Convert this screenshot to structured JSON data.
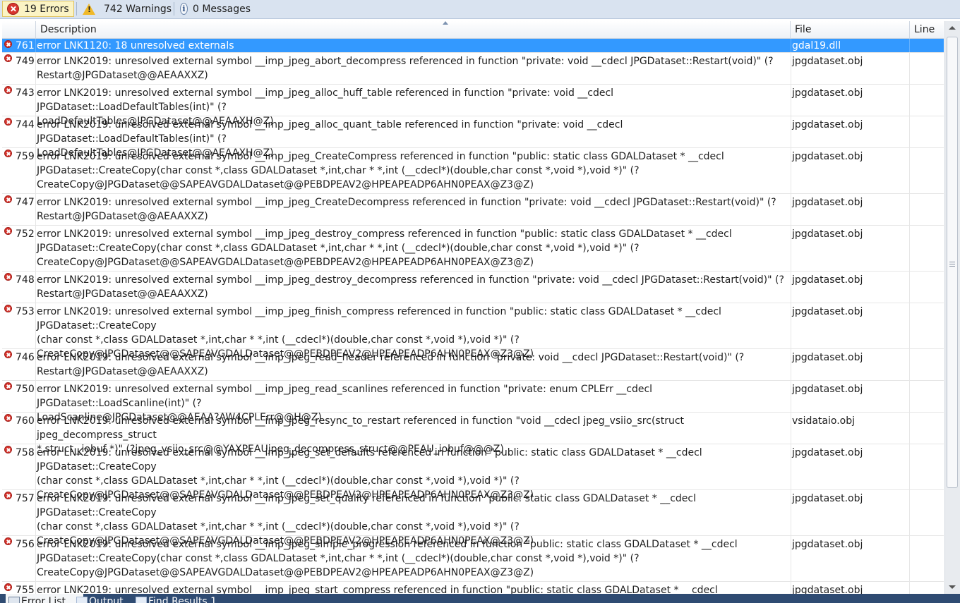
{
  "toolbar": {
    "errors_label": "19 Errors",
    "warnings_label": "742 Warnings",
    "messages_label": "0 Messages",
    "errors_icon": "error-circle-icon",
    "warnings_icon": "warning-triangle-icon",
    "messages_icon": "info-icon"
  },
  "columns": {
    "description": "Description",
    "file": "File",
    "line": "Line"
  },
  "rows": [
    {
      "num": "761",
      "desc": "error LNK1120: 18 unresolved externals",
      "file": "gdal19.dll",
      "selected": true
    },
    {
      "num": "749",
      "desc": "error LNK2019: unresolved external symbol __imp_jpeg_abort_decompress referenced in function \"private: void __cdecl JPGDataset::Restart(void)\" (?\nRestart@JPGDataset@@AEAAXXZ)",
      "file": "jpgdataset.obj"
    },
    {
      "num": "743",
      "desc": "error LNK2019: unresolved external symbol __imp_jpeg_alloc_huff_table referenced in function \"private: void __cdecl JPGDataset::LoadDefaultTables(int)\" (?\nLoadDefaultTables@JPGDataset@@AEAAXH@Z)",
      "file": "jpgdataset.obj"
    },
    {
      "num": "744",
      "desc": "error LNK2019: unresolved external symbol __imp_jpeg_alloc_quant_table referenced in function \"private: void __cdecl JPGDataset::LoadDefaultTables(int)\" (?\nLoadDefaultTables@JPGDataset@@AEAAXH@Z)",
      "file": "jpgdataset.obj"
    },
    {
      "num": "759",
      "desc": "error LNK2019: unresolved external symbol __imp_jpeg_CreateCompress referenced in function \"public: static class GDALDataset * __cdecl\nJPGDataset::CreateCopy(char const *,class GDALDataset *,int,char * *,int (__cdecl*)(double,char const *,void *),void *)\" (?\nCreateCopy@JPGDataset@@SAPEAVGDALDataset@@PEBDPEAV2@HPEAPEADP6AHN0PEAX@Z3@Z)",
      "file": "jpgdataset.obj"
    },
    {
      "num": "747",
      "desc": "error LNK2019: unresolved external symbol __imp_jpeg_CreateDecompress referenced in function \"private: void __cdecl JPGDataset::Restart(void)\" (?\nRestart@JPGDataset@@AEAAXXZ)",
      "file": "jpgdataset.obj"
    },
    {
      "num": "752",
      "desc": "error LNK2019: unresolved external symbol __imp_jpeg_destroy_compress referenced in function \"public: static class GDALDataset * __cdecl\nJPGDataset::CreateCopy(char const *,class GDALDataset *,int,char * *,int (__cdecl*)(double,char const *,void *),void *)\" (?\nCreateCopy@JPGDataset@@SAPEAVGDALDataset@@PEBDPEAV2@HPEAPEADP6AHN0PEAX@Z3@Z)",
      "file": "jpgdataset.obj"
    },
    {
      "num": "748",
      "desc": "error LNK2019: unresolved external symbol __imp_jpeg_destroy_decompress referenced in function \"private: void __cdecl JPGDataset::Restart(void)\" (?\nRestart@JPGDataset@@AEAAXXZ)",
      "file": "jpgdataset.obj"
    },
    {
      "num": "753",
      "desc": "error LNK2019: unresolved external symbol __imp_jpeg_finish_compress referenced in function \"public: static class GDALDataset * __cdecl JPGDataset::CreateCopy\n(char const *,class GDALDataset *,int,char * *,int (__cdecl*)(double,char const *,void *),void *)\" (?\nCreateCopy@JPGDataset@@SAPEAVGDALDataset@@PEBDPEAV2@HPEAPEADP6AHN0PEAX@Z3@Z)",
      "file": "jpgdataset.obj"
    },
    {
      "num": "746",
      "desc": "error LNK2019: unresolved external symbol __imp_jpeg_read_header referenced in function \"private: void __cdecl JPGDataset::Restart(void)\" (?\nRestart@JPGDataset@@AEAAXXZ)",
      "file": "jpgdataset.obj"
    },
    {
      "num": "750",
      "desc": "error LNK2019: unresolved external symbol __imp_jpeg_read_scanlines referenced in function \"private: enum CPLErr __cdecl JPGDataset::LoadScanline(int)\" (?\nLoadScanline@JPGDataset@@AEAA?AW4CPLErr@@H@Z)",
      "file": "jpgdataset.obj"
    },
    {
      "num": "760",
      "desc": "error LNK2019: unresolved external symbol __imp_jpeg_resync_to_restart referenced in function \"void __cdecl jpeg_vsiio_src(struct jpeg_decompress_struct\n*,struct _iobuf *)\" (?jpeg_vsiio_src@@YAXPEAUjpeg_decompress_struct@@PEAU_iobuf@@@Z)",
      "file": "vsidataio.obj"
    },
    {
      "num": "758",
      "desc": "error LNK2019: unresolved external symbol __imp_jpeg_set_defaults referenced in function \"public: static class GDALDataset * __cdecl JPGDataset::CreateCopy\n(char const *,class GDALDataset *,int,char * *,int (__cdecl*)(double,char const *,void *),void *)\" (?\nCreateCopy@JPGDataset@@SAPEAVGDALDataset@@PEBDPEAV2@HPEAPEADP6AHN0PEAX@Z3@Z)",
      "file": "jpgdataset.obj"
    },
    {
      "num": "757",
      "desc": "error LNK2019: unresolved external symbol __imp_jpeg_set_quality referenced in function \"public: static class GDALDataset * __cdecl JPGDataset::CreateCopy\n(char const *,class GDALDataset *,int,char * *,int (__cdecl*)(double,char const *,void *),void *)\" (?\nCreateCopy@JPGDataset@@SAPEAVGDALDataset@@PEBDPEAV2@HPEAPEADP6AHN0PEAX@Z3@Z)",
      "file": "jpgdataset.obj"
    },
    {
      "num": "756",
      "desc": "error LNK2019: unresolved external symbol __imp_jpeg_simple_progression referenced in function \"public: static class GDALDataset * __cdecl\nJPGDataset::CreateCopy(char const *,class GDALDataset *,int,char * *,int (__cdecl*)(double,char const *,void *),void *)\" (?\nCreateCopy@JPGDataset@@SAPEAVGDALDataset@@PEBDPEAV2@HPEAPEADP6AHN0PEAX@Z3@Z)",
      "file": "jpgdataset.obj"
    },
    {
      "num": "755",
      "desc": "error LNK2019: unresolved external symbol __imp_jpeg_start_compress referenced in function \"public: static class GDALDataset * __cdecl JPGDataset::CreateCopy",
      "file": "jpgdataset.obj"
    }
  ],
  "tabs": [
    {
      "label": "Error List",
      "active": true
    },
    {
      "label": "Output",
      "active": false
    },
    {
      "label": "Find Results 1",
      "active": false
    }
  ],
  "colors": {
    "selection": "#3399ff",
    "toolbar_bg": "#d9e3f0",
    "tabbar_bg": "#2f4b72",
    "error_red": "#d8352e"
  }
}
